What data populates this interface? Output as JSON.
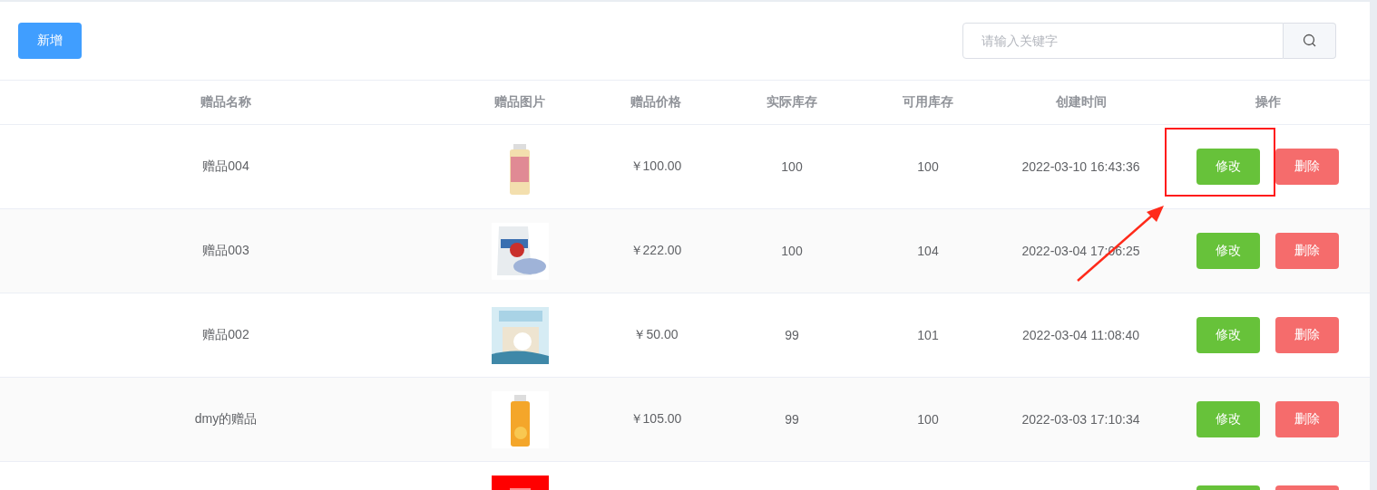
{
  "toolbar": {
    "add_button": "新增",
    "search": {
      "placeholder": "请输入关键字"
    }
  },
  "table": {
    "columns": [
      "赠品名称",
      "赠品图片",
      "赠品价格",
      "实际库存",
      "可用库存",
      "创建时间",
      "操作"
    ],
    "rows": [
      {
        "name": "赠品004",
        "price": "￥100.00",
        "actual_stock": "100",
        "available_stock": "100",
        "created": "2022-03-10 16:43:36",
        "annotated": true,
        "actions": [
          {
            "kind": "edit",
            "label": "修改"
          },
          {
            "kind": "delete",
            "label": "删除"
          }
        ]
      },
      {
        "name": "赠品003",
        "price": "￥222.00",
        "actual_stock": "100",
        "available_stock": "104",
        "created": "2022-03-04 17:06:25",
        "annotated": false,
        "actions": [
          {
            "kind": "edit",
            "label": "修改"
          },
          {
            "kind": "delete",
            "label": "删除"
          }
        ]
      },
      {
        "name": "赠品002",
        "price": "￥50.00",
        "actual_stock": "99",
        "available_stock": "101",
        "created": "2022-03-04 11:08:40",
        "annotated": false,
        "actions": [
          {
            "kind": "edit",
            "label": "修改"
          },
          {
            "kind": "delete",
            "label": "删除"
          }
        ]
      },
      {
        "name": "dmy的赠品",
        "price": "￥105.00",
        "actual_stock": "99",
        "available_stock": "100",
        "created": "2022-03-03 17:10:34",
        "annotated": false,
        "actions": [
          {
            "kind": "edit",
            "label": "修改"
          },
          {
            "kind": "delete",
            "label": "删除"
          }
        ]
      },
      {
        "annotated": false,
        "actions": [
          {
            "kind": "edit"
          },
          {
            "kind": "delete"
          }
        ]
      }
    ]
  }
}
